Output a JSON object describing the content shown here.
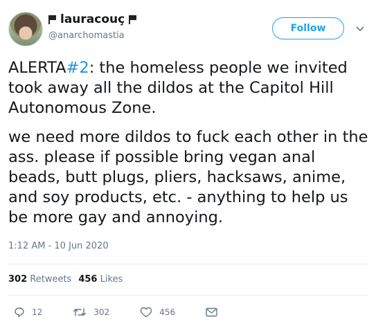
{
  "user": {
    "display_name": "lauracouç",
    "handle": "@anarchomastia"
  },
  "header": {
    "follow_label": "Follow",
    "menu_icon": "chevron-down-icon"
  },
  "tweet": {
    "alert_word": "ALERTA",
    "hashtag": "#2",
    "para1_rest": ": the homeless people we invited took away all the dildos at the Capitol Hill Autonomous Zone.",
    "para2": "we need more dildos to fuck each other in the ass. please if possible bring vegan anal beads, butt plugs, pliers, hacksaws, anime, and soy products, etc. - anything to help us be more gay and annoying.",
    "timestamp": "1:12 AM - 10 Jun 2020"
  },
  "stats": {
    "retweets_count": "302",
    "retweets_label": "Retweets",
    "likes_count": "456",
    "likes_label": "Likes"
  },
  "actions": {
    "reply_count": "12",
    "retweet_count": "302",
    "like_count": "456"
  },
  "colors": {
    "accent": "#1da1f2",
    "hashtag": "#1b95e0",
    "muted": "#657786",
    "text": "#14171a",
    "divider": "#e6ecf0"
  }
}
